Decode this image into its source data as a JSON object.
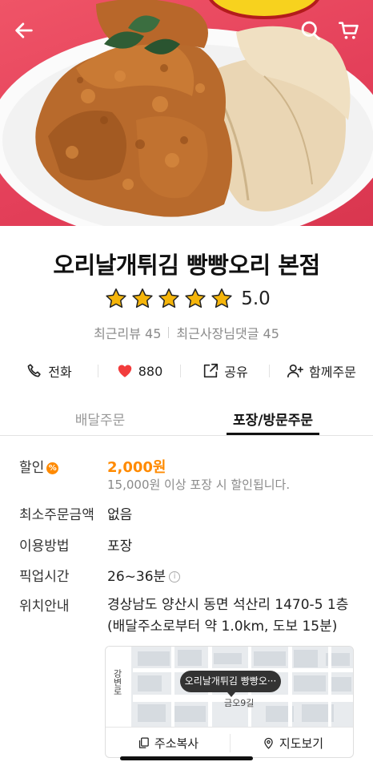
{
  "header": {
    "back_icon": "arrow-left-icon",
    "search_icon": "search-icon",
    "cart_icon": "cart-icon"
  },
  "store": {
    "name": "오리날개튀김 빵빵오리 본점",
    "rating": 5.0,
    "rating_text": "5.0",
    "stars_filled": 5,
    "recent_reviews": "최근리뷰 45",
    "recent_owner_replies": "최근사장님댓글 45"
  },
  "actions": [
    {
      "label": "전화",
      "icon": "phone-icon"
    },
    {
      "label": "880",
      "icon": "heart-icon"
    },
    {
      "label": "공유",
      "icon": "share-icon"
    },
    {
      "label": "함께주문",
      "icon": "add-person-icon"
    }
  ],
  "tabs": [
    {
      "label": "배달주문",
      "active": false
    },
    {
      "label": "포장/방문주문",
      "active": true
    }
  ],
  "info": {
    "discount_label": "할인",
    "discount_badge": "%",
    "discount_amount": "2,000원",
    "discount_note": "15,000원 이상 포장 시 할인됩니다.",
    "min_order_label": "최소주문금액",
    "min_order_value": "없음",
    "method_label": "이용방법",
    "method_value": "포장",
    "pickup_label": "픽업시간",
    "pickup_value": "26~36분",
    "pickup_info_icon": "i",
    "location_label": "위치안내",
    "address_line1": "경상남도 양산시 동면 석산리 1470-5 1층",
    "address_line2": "(배달주소로부터 약 1.0km, 도보 15분)"
  },
  "map": {
    "road_vertical": "강변로",
    "road_horizontal": "금오9길",
    "marker_label": "오리날개튀김 빵빵오···",
    "copy_address": "주소복사",
    "view_map": "지도보기"
  },
  "colors": {
    "accent": "#ff8a00",
    "star": "#f5b50a",
    "heart": "#f23c3c",
    "hero_background": "#e4405a"
  }
}
